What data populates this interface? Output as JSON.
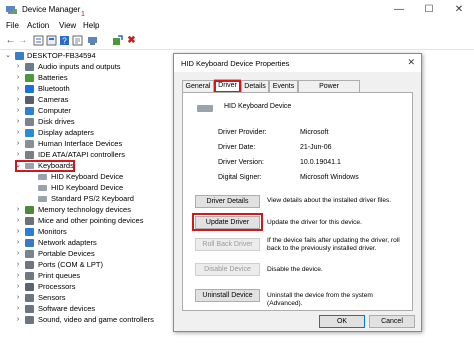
{
  "window": {
    "title": "Device Manager",
    "minimize": "—",
    "maximize": "☐",
    "close": "✕"
  },
  "menu": {
    "file": "File",
    "action": "Action",
    "view": "View",
    "help": "Help",
    "marker": "1"
  },
  "tree": {
    "root": "DESKTOP-FB34594",
    "items": [
      {
        "label": "Audio inputs and outputs",
        "icon": "audio-icon",
        "color": "#6d7b8a"
      },
      {
        "label": "Batteries",
        "icon": "battery-icon",
        "color": "#4a9a3a"
      },
      {
        "label": "Bluetooth",
        "icon": "bluetooth-icon",
        "color": "#1a73d9"
      },
      {
        "label": "Cameras",
        "icon": "camera-icon",
        "color": "#555f6b"
      },
      {
        "label": "Computer",
        "icon": "computer-icon",
        "color": "#2b7fd4"
      },
      {
        "label": "Disk drives",
        "icon": "disk-icon",
        "color": "#7a8590"
      },
      {
        "label": "Display adapters",
        "icon": "display-icon",
        "color": "#2a8dd4"
      },
      {
        "label": "Human Interface Devices",
        "icon": "hid-icon",
        "color": "#8a8f96"
      },
      {
        "label": "IDE ATA/ATAPI controllers",
        "icon": "ide-icon",
        "color": "#7a7f86"
      }
    ],
    "keyboards": "Keyboards",
    "keyboard_children": [
      "HID Keyboard Device",
      "HID Keyboard Device",
      "Standard PS/2 Keyboard"
    ],
    "items_after": [
      {
        "label": "Memory technology devices",
        "icon": "memory-icon",
        "color": "#4b8a3b"
      },
      {
        "label": "Mice and other pointing devices",
        "icon": "mouse-icon",
        "color": "#6a737d"
      },
      {
        "label": "Monitors",
        "icon": "monitor-icon",
        "color": "#2a7fd4"
      },
      {
        "label": "Network adapters",
        "icon": "network-icon",
        "color": "#3a78c8"
      },
      {
        "label": "Portable Devices",
        "icon": "portable-icon",
        "color": "#7a8390"
      },
      {
        "label": "Ports (COM & LPT)",
        "icon": "port-icon",
        "color": "#6c7580"
      },
      {
        "label": "Print queues",
        "icon": "printer-icon",
        "color": "#6f7881"
      },
      {
        "label": "Processors",
        "icon": "processor-icon",
        "color": "#5a6470"
      },
      {
        "label": "Sensors",
        "icon": "sensor-icon",
        "color": "#6d7680"
      },
      {
        "label": "Software devices",
        "icon": "software-icon",
        "color": "#6d7680"
      },
      {
        "label": "Sound, video and game controllers",
        "icon": "sound-icon",
        "color": "#6d7680"
      }
    ]
  },
  "dialog": {
    "title": "HID Keyboard Device Properties",
    "close": "✕",
    "tabs": [
      "General",
      "Driver",
      "Details",
      "Events",
      "Power Management"
    ],
    "device_name": "HID Keyboard Device",
    "properties": [
      {
        "label": "Driver Provider:",
        "value": "Microsoft"
      },
      {
        "label": "Driver Date:",
        "value": "21-Jun-06"
      },
      {
        "label": "Driver Version:",
        "value": "10.0.19041.1"
      },
      {
        "label": "Digital Signer:",
        "value": "Microsoft Windows"
      }
    ],
    "buttons": [
      {
        "label": "Driver Details",
        "desc": "View details about the installed driver files.",
        "enabled": true
      },
      {
        "label": "Update Driver",
        "desc": "Update the driver for this device.",
        "enabled": true
      },
      {
        "label": "Roll Back Driver",
        "desc": "If the device fails after updating the driver, roll back to the previously installed driver.",
        "enabled": false
      },
      {
        "label": "Disable Device",
        "desc": "Disable the device.",
        "enabled": false
      },
      {
        "label": "Uninstall Device",
        "desc": "Uninstall the device from the system (Advanced).",
        "enabled": true
      }
    ],
    "ok": "OK",
    "cancel": "Cancel"
  },
  "colors": {
    "highlight_red": "#d0191f",
    "accent_blue": "#0078d7"
  }
}
